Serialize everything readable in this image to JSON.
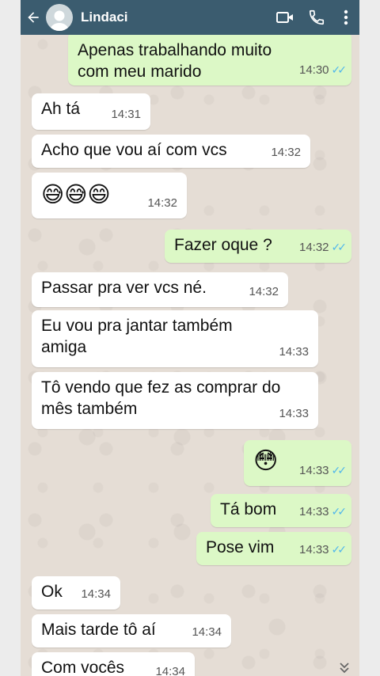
{
  "header": {
    "contact_name": "Lindaci"
  },
  "messages": [
    {
      "dir": "out",
      "text": "Apenas trabalhando muito com meu marido",
      "time": "14:30"
    },
    {
      "dir": "in",
      "text": "Ah tá",
      "time": "14:31"
    },
    {
      "dir": "in",
      "text": "Acho que vou aí com vcs",
      "time": "14:32"
    },
    {
      "dir": "in",
      "text": "😅😅😄",
      "time": "14:32"
    },
    {
      "dir": "out",
      "text": "Fazer oque ?",
      "time": "14:32"
    },
    {
      "dir": "in",
      "text": "Passar pra ver vcs né.",
      "time": "14:32"
    },
    {
      "dir": "in",
      "text": "Eu vou pra jantar também amiga",
      "time": "14:33"
    },
    {
      "dir": "in",
      "text": "Tô vendo que fez as comprar do mês também",
      "time": "14:33"
    },
    {
      "dir": "out",
      "text": "😳",
      "time": "14:33"
    },
    {
      "dir": "out",
      "text": "Tá bom",
      "time": "14:33"
    },
    {
      "dir": "out",
      "text": "Pose vim",
      "time": "14:33"
    },
    {
      "dir": "in",
      "text": "Ok",
      "time": "14:34"
    },
    {
      "dir": "in",
      "text": "Mais tarde tô aí",
      "time": "14:34"
    },
    {
      "dir": "in",
      "text": "Com vocês",
      "time": "14:34"
    }
  ],
  "colors": {
    "header": "#3b5c6f",
    "incoming": "#ffffff",
    "outgoing": "#dcf8c6",
    "read_ticks": "#4fb6ec"
  }
}
